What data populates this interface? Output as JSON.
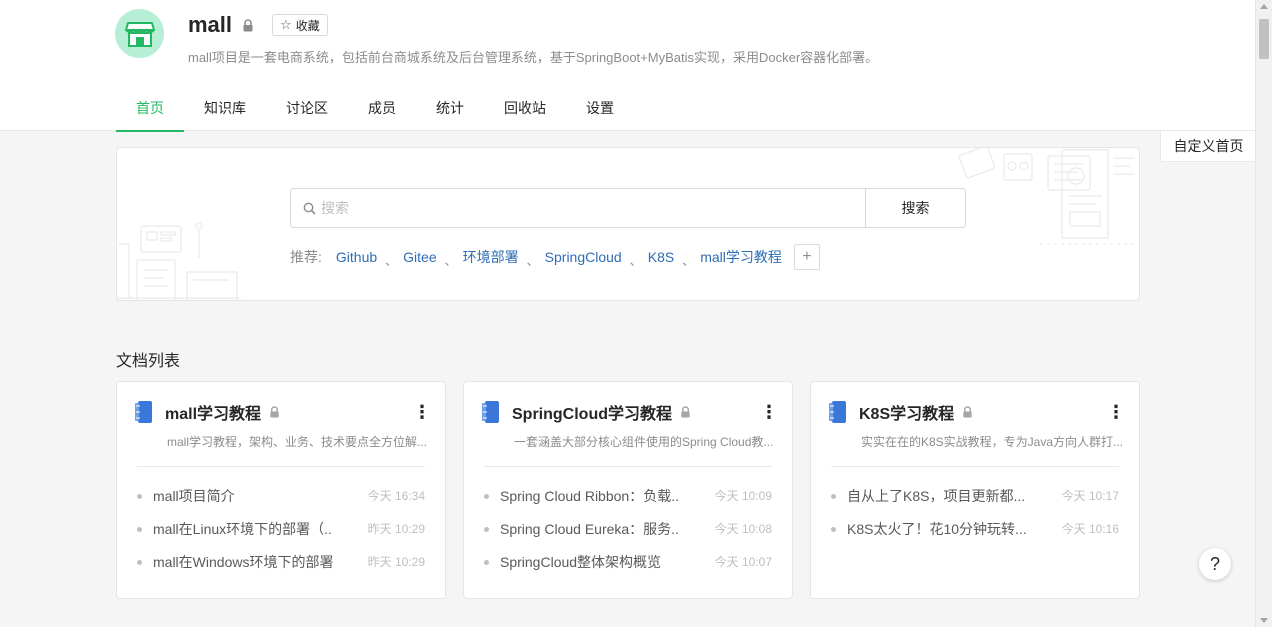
{
  "header": {
    "title": "mall",
    "favorite_label": "收藏",
    "description": "mall项目是一套电商系统，包括前台商城系统及后台管理系统，基于SpringBoot+MyBatis实现，采用Docker容器化部署。",
    "logo_color": "#b6efd5",
    "accent_color": "#25b864"
  },
  "tabs": [
    {
      "label": "首页",
      "active": true
    },
    {
      "label": "知识库",
      "active": false
    },
    {
      "label": "讨论区",
      "active": false
    },
    {
      "label": "成员",
      "active": false
    },
    {
      "label": "统计",
      "active": false
    },
    {
      "label": "回收站",
      "active": false
    },
    {
      "label": "设置",
      "active": false
    }
  ],
  "customize_label": "自定义首页",
  "search": {
    "placeholder": "搜索",
    "button_label": "搜索",
    "recommend_label": "推荐:",
    "recommend_links": [
      "Github",
      "Gitee",
      "环境部署",
      "SpringCloud",
      "K8S",
      "mall学习教程"
    ],
    "separator": "、",
    "add_label": "+"
  },
  "doc_section_title": "文档列表",
  "cards": [
    {
      "name": "mall学习教程",
      "description": "mall学习教程，架构、业务、技术要点全方位解...",
      "docs": [
        {
          "title": "mall项目简介",
          "time": "今天 16:34"
        },
        {
          "title": "mall在Linux环境下的部署（...",
          "time": "昨天 10:29"
        },
        {
          "title": "mall在Windows环境下的部署",
          "time": "昨天 10:29"
        }
      ]
    },
    {
      "name": "SpringCloud学习教程",
      "description": "一套涵盖大部分核心组件使用的Spring Cloud教...",
      "docs": [
        {
          "title": "Spring Cloud Ribbon：负载...",
          "time": "今天 10:09"
        },
        {
          "title": "Spring Cloud Eureka：服务...",
          "time": "今天 10:08"
        },
        {
          "title": "SpringCloud整体架构概览",
          "time": "今天 10:07"
        }
      ]
    },
    {
      "name": "K8S学习教程",
      "description": "实实在在的K8S实战教程，专为Java方向人群打...",
      "docs": [
        {
          "title": "自从上了K8S，项目更新都...",
          "time": "今天 10:17"
        },
        {
          "title": "K8S太火了！花10分钟玩转...",
          "time": "今天 10:16"
        }
      ]
    }
  ],
  "card_more_label": "⋮",
  "help_label": "?"
}
